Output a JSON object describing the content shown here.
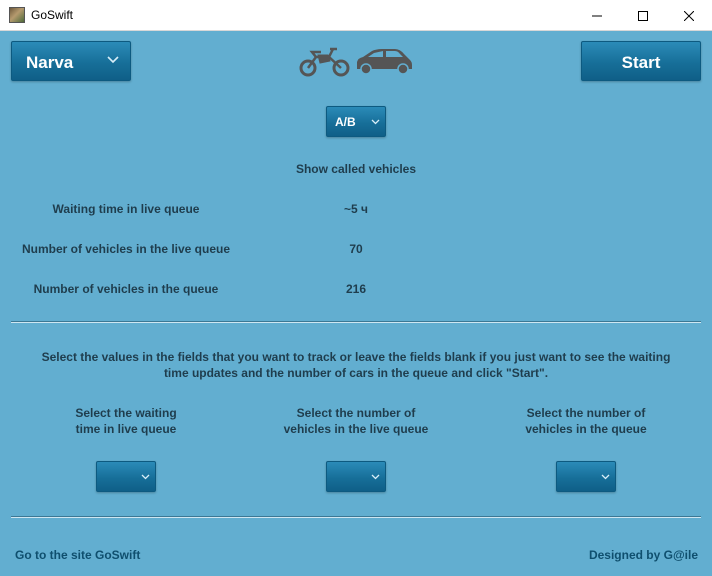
{
  "window": {
    "title": "GoSwift",
    "app_icon": "landscape-icon",
    "controls": [
      "minimize-icon",
      "maximize-icon",
      "close-icon"
    ]
  },
  "header": {
    "city_select": {
      "value": "Narva",
      "icon": "chevron-down-icon"
    },
    "vehicle_icons": [
      "motorcycle-icon",
      "car-icon"
    ],
    "start_label": "Start"
  },
  "category_select": {
    "value": "A/B",
    "icon": "chevron-down-icon"
  },
  "show_called_label": "Show called vehicles",
  "stats": [
    {
      "label": "Waiting time in live queue",
      "value": "~5 ч"
    },
    {
      "label": "Number of vehicles in the live queue",
      "value": "70"
    },
    {
      "label": "Number of vehicles in the queue",
      "value": "216"
    }
  ],
  "tracking": {
    "instructions_line1": "Select the values in the fields that you want to track or leave the fields blank if you just want to see the waiting",
    "instructions_line2": "time updates and the number of cars in the queue and click \"Start\".",
    "fields": [
      {
        "label_line1": "Select the waiting",
        "label_line2": "time in live queue",
        "value": ""
      },
      {
        "label_line1": "Select the number of",
        "label_line2": "vehicles in the live queue",
        "value": ""
      },
      {
        "label_line1": "Select the number of",
        "label_line2": "vehicles in the queue",
        "value": ""
      }
    ]
  },
  "footer": {
    "site_link": "Go to the site GoSwift",
    "credit": "Designed by G@ile"
  },
  "colors": {
    "background": "#62aed0",
    "button": "#1a75a0",
    "text": "#1f3d4d",
    "link": "#0f4f6e"
  }
}
